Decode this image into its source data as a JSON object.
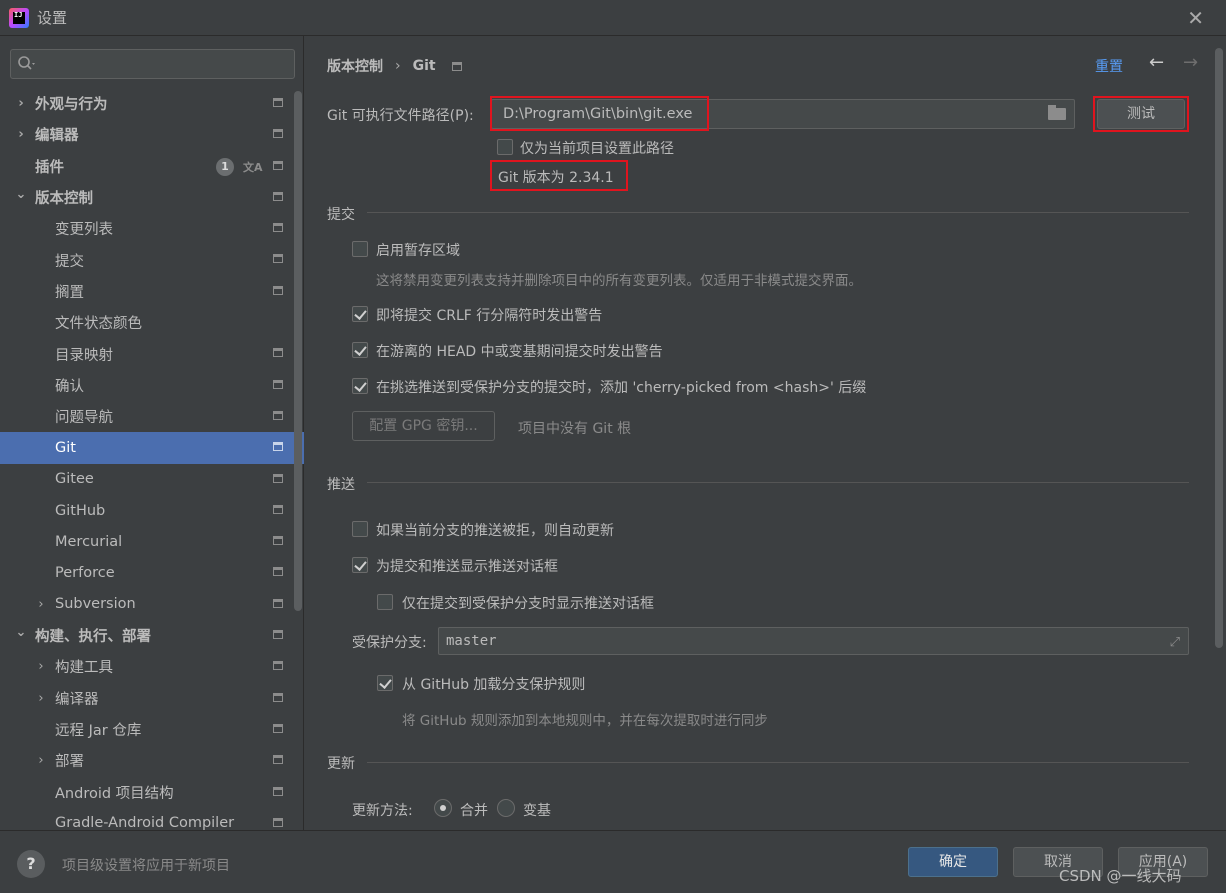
{
  "window": {
    "title": "设置",
    "close_icon": "close-icon"
  },
  "search": {
    "placeholder": ""
  },
  "sidebar": {
    "items": [
      {
        "label": "外观与行为",
        "level": 0,
        "arrow": "›",
        "bold": true
      },
      {
        "label": "编辑器",
        "level": 0,
        "arrow": "›",
        "bold": true
      },
      {
        "label": "插件",
        "level": 0,
        "arrow": "",
        "bold": true,
        "badge": "1"
      },
      {
        "label": "版本控制",
        "level": 0,
        "arrow": "⌄",
        "bold": true
      },
      {
        "label": "变更列表",
        "level": 1
      },
      {
        "label": "提交",
        "level": 1
      },
      {
        "label": "搁置",
        "level": 1
      },
      {
        "label": "文件状态颜色",
        "level": 1
      },
      {
        "label": "目录映射",
        "level": 1
      },
      {
        "label": "确认",
        "level": 1
      },
      {
        "label": "问题导航",
        "level": 1
      },
      {
        "label": "Git",
        "level": 1,
        "selected": true
      },
      {
        "label": "Gitee",
        "level": 1
      },
      {
        "label": "GitHub",
        "level": 1
      },
      {
        "label": "Mercurial",
        "level": 1
      },
      {
        "label": "Perforce",
        "level": 1
      },
      {
        "label": "Subversion",
        "level": 1,
        "arrow": "›"
      },
      {
        "label": "构建、执行、部署",
        "level": 0,
        "arrow": "⌄",
        "bold": true
      },
      {
        "label": "构建工具",
        "level": 1,
        "arrow": "›"
      },
      {
        "label": "编译器",
        "level": 1,
        "arrow": "›"
      },
      {
        "label": "远程 Jar 仓库",
        "level": 1
      },
      {
        "label": "部署",
        "level": 1,
        "arrow": "›"
      },
      {
        "label": "Android 项目结构",
        "level": 1
      },
      {
        "label": "Gradle-Android Compiler",
        "level": 1
      }
    ]
  },
  "header": {
    "breadcrumb_parent": "版本控制",
    "breadcrumb_sep": "›",
    "breadcrumb_current": "Git",
    "reset": "重置",
    "back_arrow": "←",
    "forward_arrow": "→"
  },
  "git": {
    "path_label": "Git 可执行文件路径(P):",
    "path_value": "D:\\Program\\Git\\bin\\git.exe",
    "test_button": "测试",
    "project_only_label": "仅为当前项目设置此路径",
    "version_text": "Git 版本为 2.34.1"
  },
  "commit": {
    "section": "提交",
    "staging_label": "启用暂存区域",
    "staging_hint": "这将禁用变更列表支持并删除项目中的所有变更列表。仅适用于非模式提交界面。",
    "crlf_label": "即将提交 CRLF 行分隔符时发出警告",
    "head_label": "在游离的 HEAD 中或变基期间提交时发出警告",
    "cherry_label": "在挑选推送到受保护分支的提交时，添加 'cherry-picked from <hash>' 后缀",
    "gpg_button": "配置 GPG 密钥...",
    "gpg_hint": "项目中没有 Git 根"
  },
  "push": {
    "section": "推送",
    "auto_update_label": "如果当前分支的推送被拒，则自动更新",
    "show_dialog_label": "为提交和推送显示推送对话框",
    "protected_only_label": "仅在提交到受保护分支时显示推送对话框",
    "protected_branch_label": "受保护分支:",
    "protected_branch_value": "master",
    "github_rules_label": "从 GitHub 加载分支保护规则",
    "github_rules_hint": "将 GitHub 规则添加到本地规则中，并在每次提取时进行同步"
  },
  "update": {
    "section": "更新",
    "method_label": "更新方法:",
    "merge_label": "合并",
    "rebase_label": "变基"
  },
  "footer": {
    "hint": "项目级设置将应用于新项目",
    "help": "?",
    "ok": "确定",
    "cancel": "取消",
    "apply": "应用(A)",
    "watermark": "CSDN @一线大码"
  }
}
